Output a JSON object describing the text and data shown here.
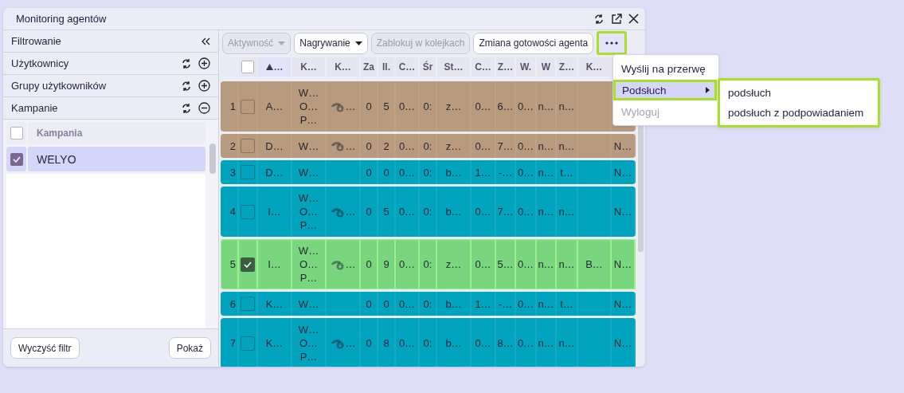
{
  "window": {
    "title": "Monitoring agentów"
  },
  "filter_panel": {
    "title": "Filtrowanie",
    "sections": [
      {
        "label": "Użytkownicy",
        "expanded": false
      },
      {
        "label": "Grupy użytkowników",
        "expanded": false
      },
      {
        "label": "Kampanie",
        "expanded": true
      }
    ],
    "campaign_list": {
      "header": "Kampania",
      "header_checked": false,
      "items": [
        {
          "label": "WELYO",
          "checked": true,
          "selected": true
        }
      ]
    },
    "buttons": [
      "Wyczyść filtr",
      "Pokaż"
    ]
  },
  "toolbar": [
    {
      "label": "Aktywność",
      "dropdown": true,
      "disabled": true
    },
    {
      "label": "Nagrywanie",
      "dropdown": true,
      "disabled": false
    },
    {
      "label": "Zablokuj w kolejkach",
      "dropdown": false,
      "disabled": true
    },
    {
      "label": "Zmiana gotowości agenta",
      "dropdown": false,
      "disabled": false
    }
  ],
  "more_button": {
    "highlighted": true
  },
  "menu": {
    "items": [
      {
        "label": "Wyślij na przerwę",
        "disabled": false,
        "highlighted": false,
        "submenu": false
      },
      {
        "label": "Podsłuch",
        "disabled": false,
        "highlighted": true,
        "submenu": true
      },
      {
        "label": "Wyloguj",
        "disabled": true,
        "highlighted": false,
        "submenu": false
      }
    ]
  },
  "submenu": {
    "highlighted": true,
    "items": [
      "podsłuch",
      "podsłuch z podpowiadaniem"
    ]
  },
  "table": {
    "header_checked": false,
    "columns": [
      {
        "label": "…",
        "sorted": true
      },
      {
        "label": "K…",
        "sorted": false
      },
      {
        "label": "K…",
        "sorted": false
      },
      {
        "label": "Za",
        "sorted": false
      },
      {
        "label": "Il.",
        "sorted": false
      },
      {
        "label": "C…",
        "sorted": false
      },
      {
        "label": "Śr",
        "sorted": false
      },
      {
        "label": "St…",
        "sorted": false
      },
      {
        "label": "C…",
        "sorted": false
      },
      {
        "label": "Z…",
        "sorted": false
      },
      {
        "label": "W.",
        "sorted": false
      },
      {
        "label": "W",
        "sorted": false
      },
      {
        "label": "Z…",
        "sorted": false
      },
      {
        "label": "K…",
        "sorted": false
      }
    ],
    "rows": [
      {
        "number": "1",
        "color": "#b89a7e",
        "checked": false,
        "agent": "A…",
        "groups": [
          "W…",
          "O…",
          "P…"
        ],
        "recording": "…",
        "values": [
          "0",
          "5",
          "0…",
          "0:",
          "z…",
          "0…",
          "6…",
          "0…",
          "n…",
          "n…"
        ]
      },
      {
        "number": "2",
        "color": "#b89a7e",
        "checked": false,
        "agent": "D…",
        "groups": [
          "W…"
        ],
        "recording": "…",
        "values": [
          "0",
          "2",
          "0…",
          "0:",
          "z…",
          "0…",
          "7…",
          "0…",
          "n…",
          "n…"
        ],
        "column_16": "N…"
      },
      {
        "number": "3",
        "color": "#00a3bd",
        "checked": false,
        "agent": "D…",
        "groups": [
          "W…"
        ],
        "values": [
          "0",
          "0",
          "0…",
          "0:",
          "b…",
          "1…",
          "-…",
          "0…",
          "n…",
          "t…"
        ],
        "column_16": "N…"
      },
      {
        "number": "4",
        "color": "#00a3bd",
        "checked": false,
        "agent": "I…",
        "groups": [
          "W…",
          "O…",
          "P…"
        ],
        "recording": "…",
        "values": [
          "0",
          "5",
          "0…",
          "0:",
          "b…",
          "0…",
          "7…",
          "0…",
          "n…",
          "n…"
        ],
        "column_16": "N…"
      },
      {
        "number": "5",
        "color": "#78d67f",
        "checked": true,
        "agent": "I…",
        "groups": [
          "W…",
          "O…",
          "P…"
        ],
        "recording": "…",
        "values": [
          "0",
          "9",
          "0…",
          "0:",
          "z…",
          "0…",
          "5…",
          "0…",
          "n…",
          "n…"
        ],
        "column_15": "B…",
        "column_16": "N…"
      },
      {
        "number": "6",
        "color": "#00a3bd",
        "checked": false,
        "agent": "K…",
        "groups": [
          "W…"
        ],
        "values": [
          "0",
          "0",
          "0…",
          "0:",
          "b…",
          "1…",
          "-…",
          "0…",
          "n…",
          "t…"
        ],
        "column_16": "N…"
      },
      {
        "number": "7",
        "color": "#00a3bd",
        "checked": false,
        "agent": "K…",
        "groups": [
          "W…",
          "O…",
          "P…"
        ],
        "recording": "…",
        "values": [
          "0",
          "8",
          "0…",
          "0:",
          "b…",
          "0…",
          "8…",
          "0…",
          "n…",
          "n…"
        ],
        "column_16": "N…"
      }
    ]
  }
}
